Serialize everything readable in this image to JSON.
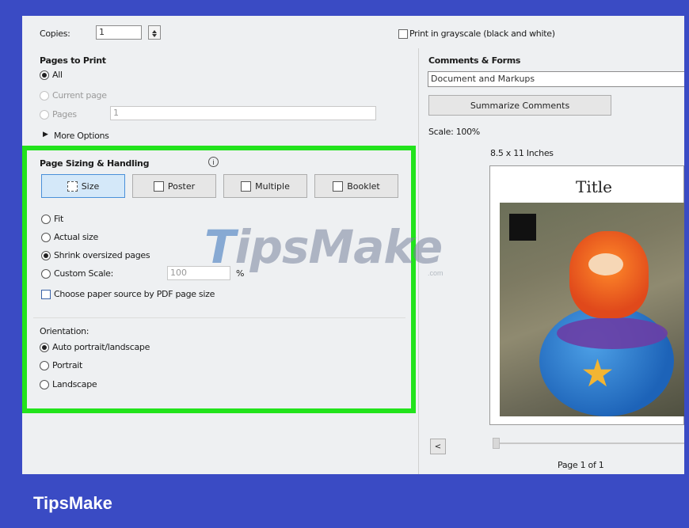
{
  "copies": {
    "label": "Copies:",
    "value": "1"
  },
  "grayscale_label": "Print in grayscale (black and white)",
  "pages_to_print": {
    "title": "Pages to Print",
    "all": "All",
    "current_page": "Current page",
    "pages": "Pages",
    "pages_value": "1",
    "more_options": "More Options"
  },
  "comments_forms": {
    "title": "Comments & Forms",
    "selected": "Document and Markups",
    "summarize_button": "Summarize Comments"
  },
  "page_sizing": {
    "title": "Page Sizing & Handling",
    "tabs": [
      "Size",
      "Poster",
      "Multiple",
      "Booklet"
    ],
    "fit": "Fit",
    "actual_size": "Actual size",
    "shrink": "Shrink oversized pages",
    "custom_scale": "Custom Scale:",
    "custom_scale_value": "100",
    "percent": "%",
    "choose_paper": "Choose paper source by PDF page size"
  },
  "orientation": {
    "title": "Orientation:",
    "auto": "Auto portrait/landscape",
    "portrait": "Portrait",
    "landscape": "Landscape"
  },
  "preview": {
    "scale": "Scale: 100%",
    "paper_size": "8.5 x 11 Inches",
    "doc_title": "Title",
    "page_info": "Page 1 of 1",
    "prev_button": "<"
  },
  "watermark": {
    "text_t": "T",
    "text_rest": "ipsMake",
    "small": ".com"
  },
  "footer_brand": "TipsMake",
  "colors": {
    "background": "#3a4bc4",
    "highlight": "#22e31c"
  }
}
